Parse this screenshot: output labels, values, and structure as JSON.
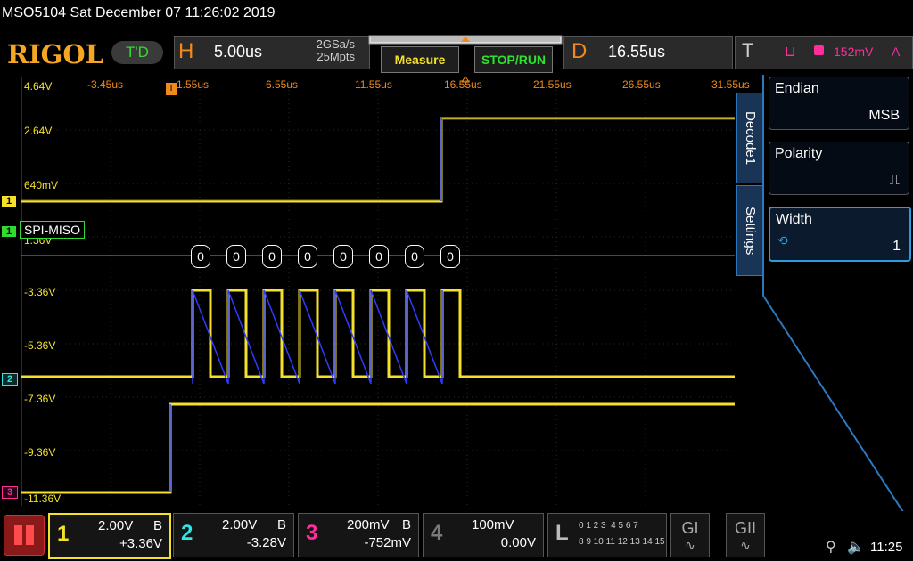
{
  "titlebar": {
    "text": "MSO5104  Sat December 07 11:26:02 2019"
  },
  "topbar": {
    "logo": "RIGOL",
    "trigger_state": "T'D",
    "horizontal": {
      "label": "H",
      "timebase": "5.00us",
      "sample_rate": "2GSa/s",
      "memory_depth": "25Mpts"
    },
    "measure_label": "Measure",
    "stop_run_label": "STOP/RUN",
    "delay": {
      "label": "D",
      "value": "16.55us"
    },
    "trigger": {
      "label": "T",
      "level": "152mV",
      "source": "A",
      "edge_symbol": "⊔"
    }
  },
  "screen": {
    "volt_labels": [
      "4.64V",
      "2.64V",
      "640mV",
      "1.36V",
      "-3.36V",
      "-5.36V",
      "-7.36V",
      "-9.36V",
      "-11.36V"
    ],
    "time_labels": [
      "-3.45us",
      "1.55us",
      "6.55us",
      "11.55us",
      "16.55us",
      "21.55us",
      "26.55us",
      "31.55us"
    ],
    "decode_label": "SPI-MISO",
    "decoded_bytes": [
      "0",
      "0",
      "0",
      "0",
      "0",
      "0",
      "0",
      "0"
    ],
    "markers": {
      "ch1": "1",
      "ch2": "2",
      "ch3": "3",
      "bus": "1"
    }
  },
  "side_menu": {
    "tab_top": "Decode1",
    "tab_bottom": "Settings",
    "items": [
      {
        "title": "Endian",
        "value": "MSB"
      },
      {
        "title": "Polarity",
        "value": "⎍"
      },
      {
        "title": "Width",
        "value": "1"
      }
    ]
  },
  "channels": [
    {
      "num": "1",
      "scale": "2.00V",
      "coupling": "B",
      "offset": "+3.36V",
      "color": "#f5e12a"
    },
    {
      "num": "2",
      "scale": "2.00V",
      "coupling": "B",
      "offset": "-3.28V",
      "color": "#2ee6e6"
    },
    {
      "num": "3",
      "scale": "200mV",
      "coupling": "B",
      "offset": "-752mV",
      "color": "#ff2d9d"
    },
    {
      "num": "4",
      "scale": "100mV",
      "coupling": "",
      "offset": "0.00V",
      "color": "#7a7a7a"
    }
  ],
  "logic": {
    "label": "L",
    "row1": "0 1 2 3  4 5 6 7",
    "row2": "8 9 10 11 12 13 14 15"
  },
  "decoders": {
    "g1": "GI",
    "g2": "GII"
  },
  "status": {
    "time": "11:25",
    "usb_icon": "usb-icon",
    "sound_icon": "sound-muted-icon"
  },
  "colors": {
    "ch1": "#f5e12a",
    "ch2": "#2ee6e6",
    "ch3": "#ff2d9d",
    "accent": "#f08a1c",
    "blue_trace": "#2d3cff",
    "bus": "#2fdc2f"
  }
}
